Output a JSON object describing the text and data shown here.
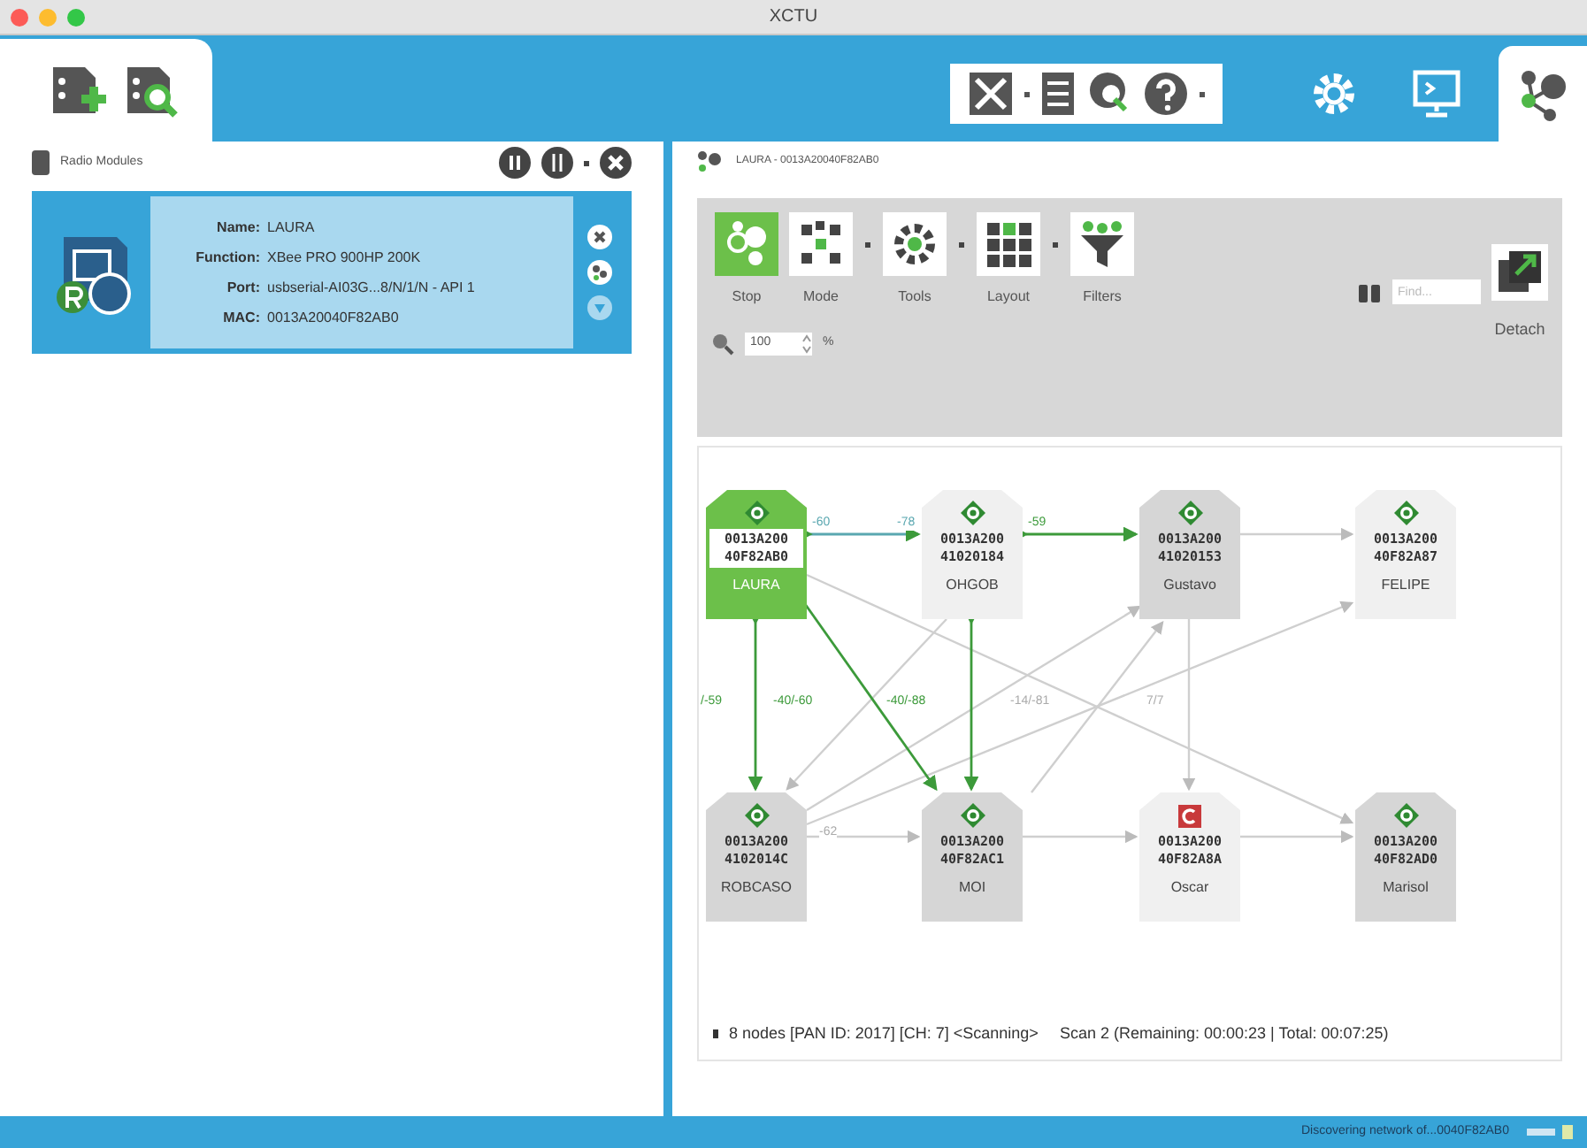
{
  "window": {
    "title": "XCTU"
  },
  "modes": [
    {
      "kind": "configuration",
      "selected": false
    },
    {
      "kind": "consoles",
      "selected": false
    },
    {
      "kind": "network",
      "selected": true
    }
  ],
  "radio_modules": {
    "title": "Radio Modules",
    "modules": [
      {
        "selected": true,
        "fields": [
          {
            "label": "Name:",
            "value": "LAURA"
          },
          {
            "label": "Function:",
            "value": "XBee PRO 900HP 200K"
          },
          {
            "label": "Port:",
            "value": "usbserial-AI03G...8/N/1/N - API 1"
          },
          {
            "label": "MAC:",
            "value": "0013A20040F82AB0"
          }
        ]
      }
    ]
  },
  "network": {
    "title": "LAURA - 0013A20040F82AB0",
    "toolbar": [
      {
        "kind": "stop",
        "label": "Stop",
        "selected": true
      },
      {
        "kind": "mode",
        "label": "Mode",
        "selected": false
      },
      {
        "kind": "tools",
        "label": "Tools",
        "selected": false
      },
      {
        "kind": "layout",
        "label": "Layout",
        "selected": false
      },
      {
        "kind": "filters",
        "label": "Filters",
        "selected": false
      }
    ],
    "find": {
      "placeholder": "Find..."
    },
    "detach": "Detach",
    "zoom": {
      "value": "100",
      "unit": "%"
    },
    "nodes": [
      {
        "kind": "router",
        "selected": true,
        "dimmed": false,
        "address": [
          "0013A200",
          "40F82AB0"
        ],
        "name": "LAURA"
      },
      {
        "kind": "router",
        "selected": false,
        "dimmed": true,
        "address": [
          "0013A200",
          "41020184"
        ],
        "name": "OHGOB"
      },
      {
        "kind": "router",
        "selected": false,
        "dimmed": false,
        "address": [
          "0013A200",
          "41020153"
        ],
        "name": "Gustavo"
      },
      {
        "kind": "router",
        "selected": false,
        "dimmed": true,
        "address": [
          "0013A200",
          "40F82A87"
        ],
        "name": "FELIPE"
      },
      {
        "kind": "router",
        "selected": false,
        "dimmed": false,
        "address": [
          "0013A200",
          "4102014C"
        ],
        "name": "ROBCASO"
      },
      {
        "kind": "router",
        "selected": false,
        "dimmed": false,
        "address": [
          "0013A200",
          "40F82AC1"
        ],
        "name": "MOI"
      },
      {
        "kind": "coordinator",
        "selected": false,
        "dimmed": true,
        "address": [
          "0013A200",
          "40F82A8A"
        ],
        "name": "Oscar"
      },
      {
        "kind": "router",
        "selected": false,
        "dimmed": false,
        "address": [
          "0013A200",
          "40F82AD0"
        ],
        "name": "Marisol"
      }
    ],
    "link_labels": [
      "-60",
      "-78",
      "-59",
      "/-59",
      "-40/-60",
      "-40/-88",
      "-14/-81",
      "7/7",
      "-62"
    ],
    "summary": "8 nodes [PAN ID: 2017] [CH: 7] <Scanning>",
    "scan": "Scan 2 (Remaining: 00:00:23 | Total: 00:07:25)"
  },
  "status_bar": "Discovering network of...0040F82AB0"
}
